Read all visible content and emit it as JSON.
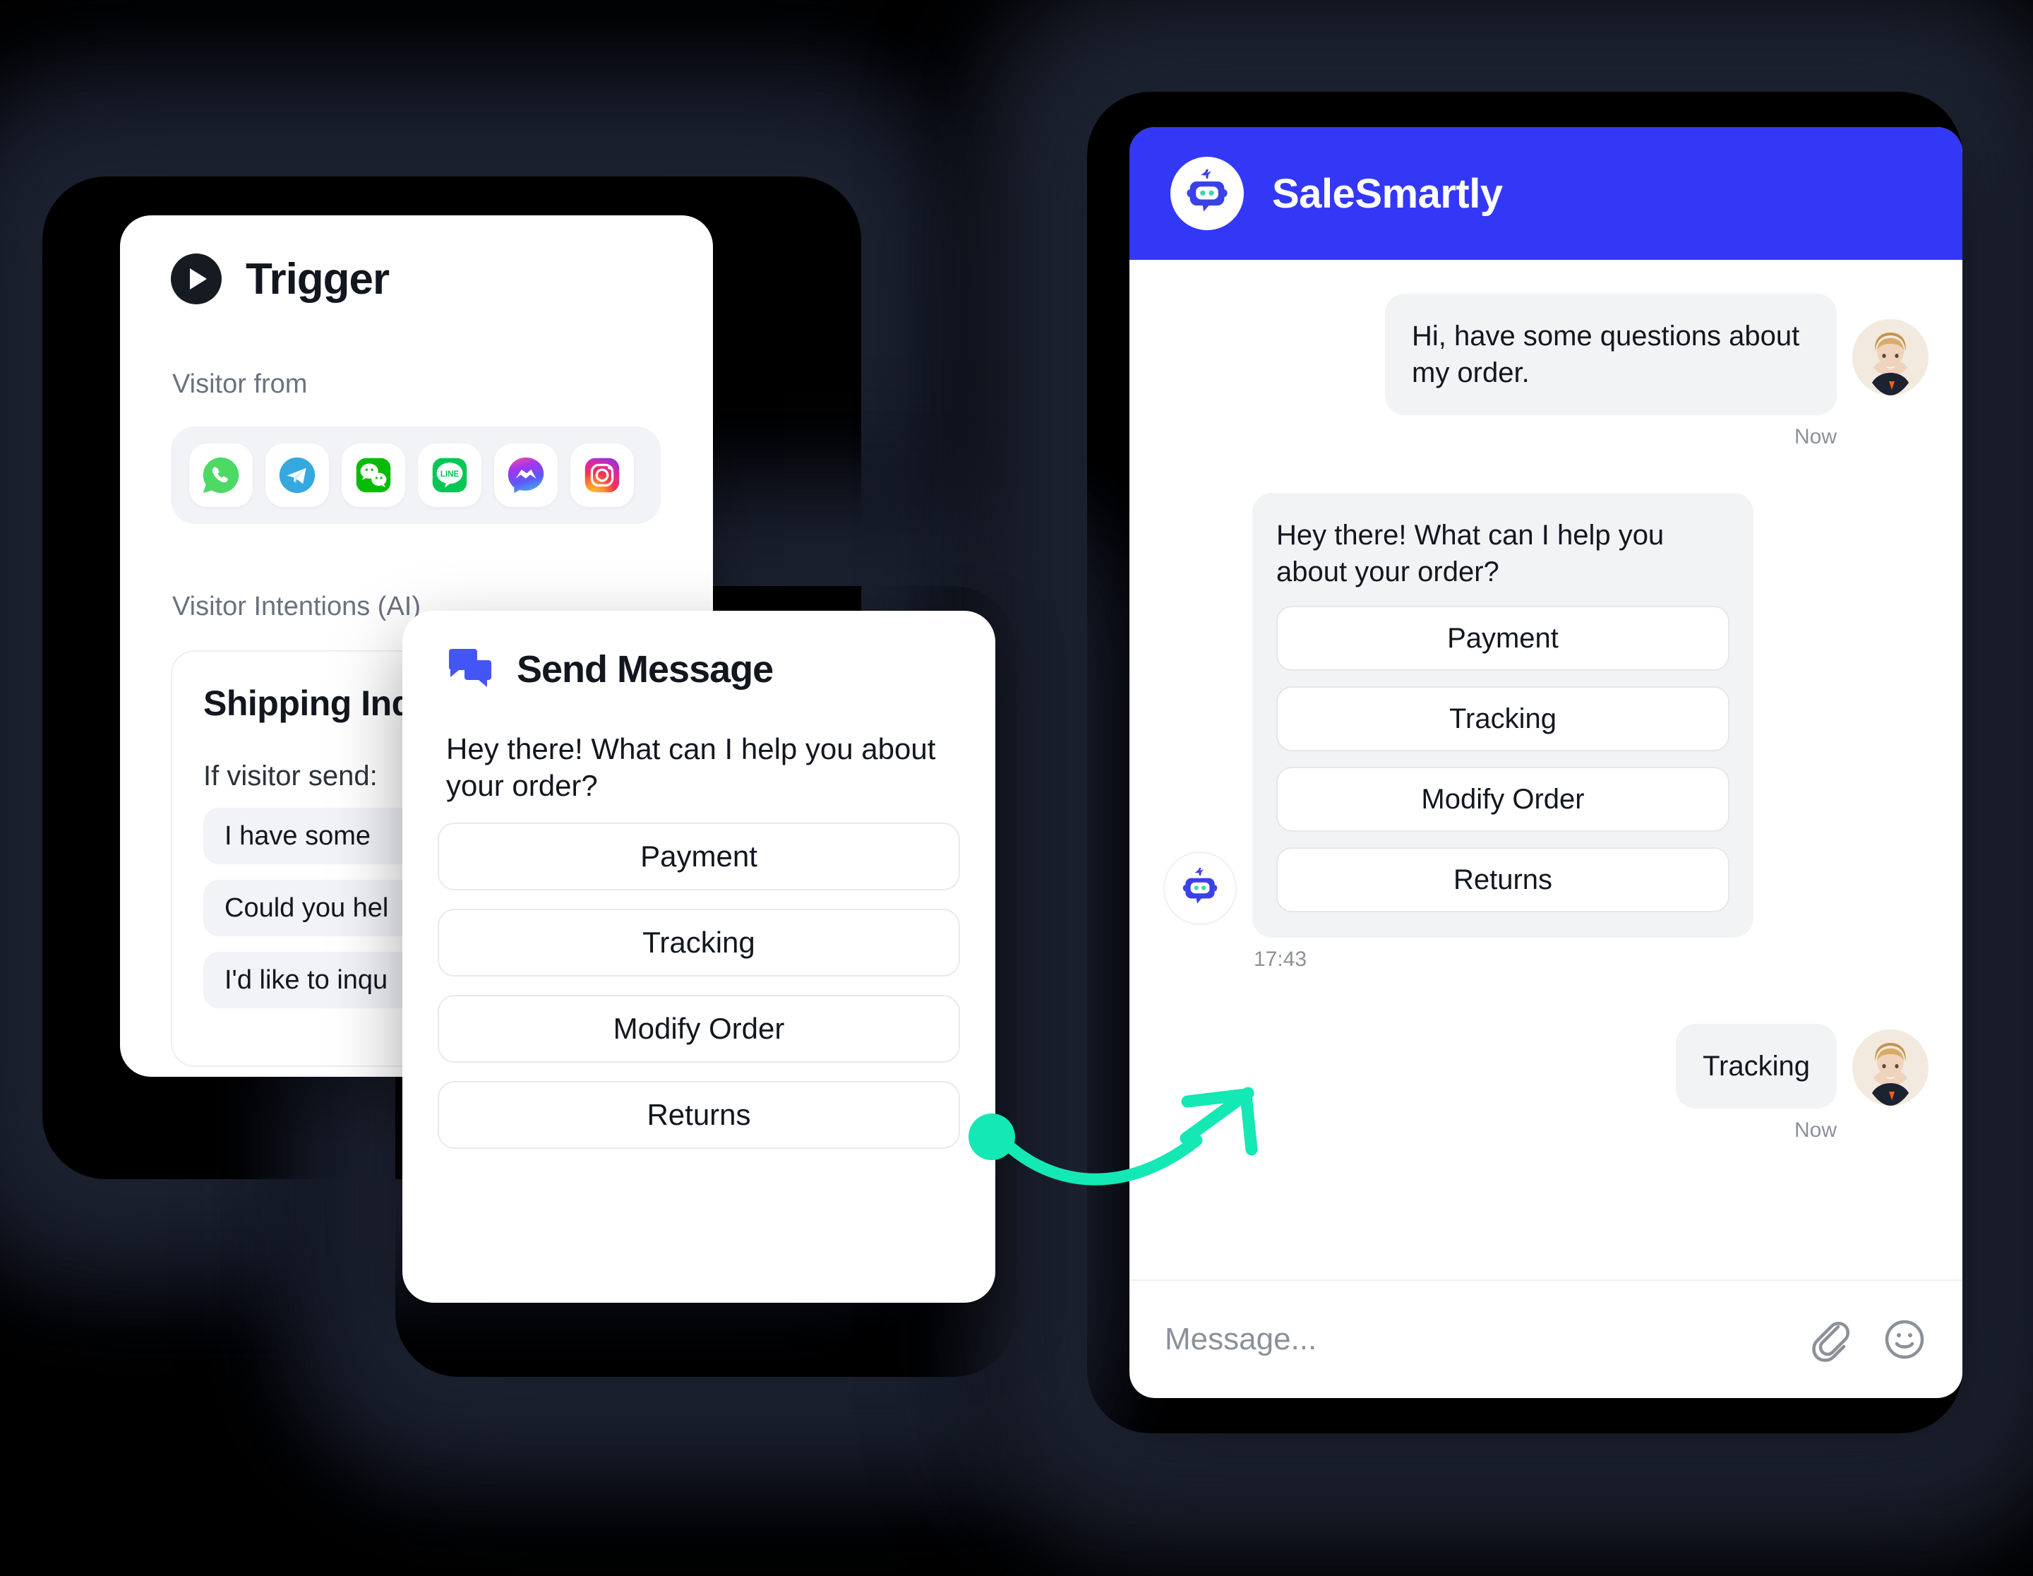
{
  "theme": {
    "background": "#000000",
    "brand_blue": "#3338F7",
    "icon_blue": "#4355F5",
    "accent_teal": "#14E8B4",
    "bubble_grey": "#F1F3F5",
    "text_dark": "#12171F",
    "text_muted": "#6A727E"
  },
  "trigger_card": {
    "title": "Trigger",
    "icon": "play-circle-icon",
    "visitor_from_label": "Visitor from",
    "channels": [
      {
        "name": "whatsapp-icon",
        "label": "WhatsApp"
      },
      {
        "name": "telegram-icon",
        "label": "Telegram"
      },
      {
        "name": "wechat-icon",
        "label": "WeChat"
      },
      {
        "name": "line-icon",
        "label": "LINE"
      },
      {
        "name": "messenger-icon",
        "label": "Messenger"
      },
      {
        "name": "instagram-icon",
        "label": "Instagram"
      }
    ],
    "intentions_label": "Visitor Intentions (AI)",
    "intention_panel": {
      "title": "Shipping Inqu",
      "subtitle": "If visitor send:",
      "samples": [
        "I  have  some  ",
        "Could you hel",
        "I'd like to inqu"
      ]
    }
  },
  "send_message_card": {
    "title": "Send Message",
    "icon": "chat-bubbles-icon",
    "message": "Hey there! What can I help you about your order?",
    "options": [
      "Payment",
      "Tracking",
      "Modify Order",
      "Returns"
    ]
  },
  "chat_widget": {
    "header": {
      "brand": "SaleSmartly",
      "logo": "robot-avatar-icon"
    },
    "messages": [
      {
        "role": "visitor",
        "text": "Hi, have some questions about my order.",
        "timestamp": "Now",
        "avatar": "woman-photo-avatar"
      },
      {
        "role": "bot",
        "text": "Hey there! What can I help you about your order?",
        "options": [
          "Payment",
          "Tracking",
          "Modify Order",
          "Returns"
        ],
        "timestamp": "17:43",
        "avatar": "robot-avatar-icon"
      },
      {
        "role": "visitor",
        "text": "Tracking",
        "timestamp": "Now",
        "avatar": "woman-photo-avatar"
      }
    ],
    "composer": {
      "placeholder": "Message...",
      "attach_icon": "paperclip-icon",
      "emoji_icon": "smiley-face-icon"
    }
  },
  "connector": {
    "name": "curved-arrow-connector",
    "color": "#14E8B4",
    "from": "send-message-card",
    "to": "chat-bot-reply"
  }
}
